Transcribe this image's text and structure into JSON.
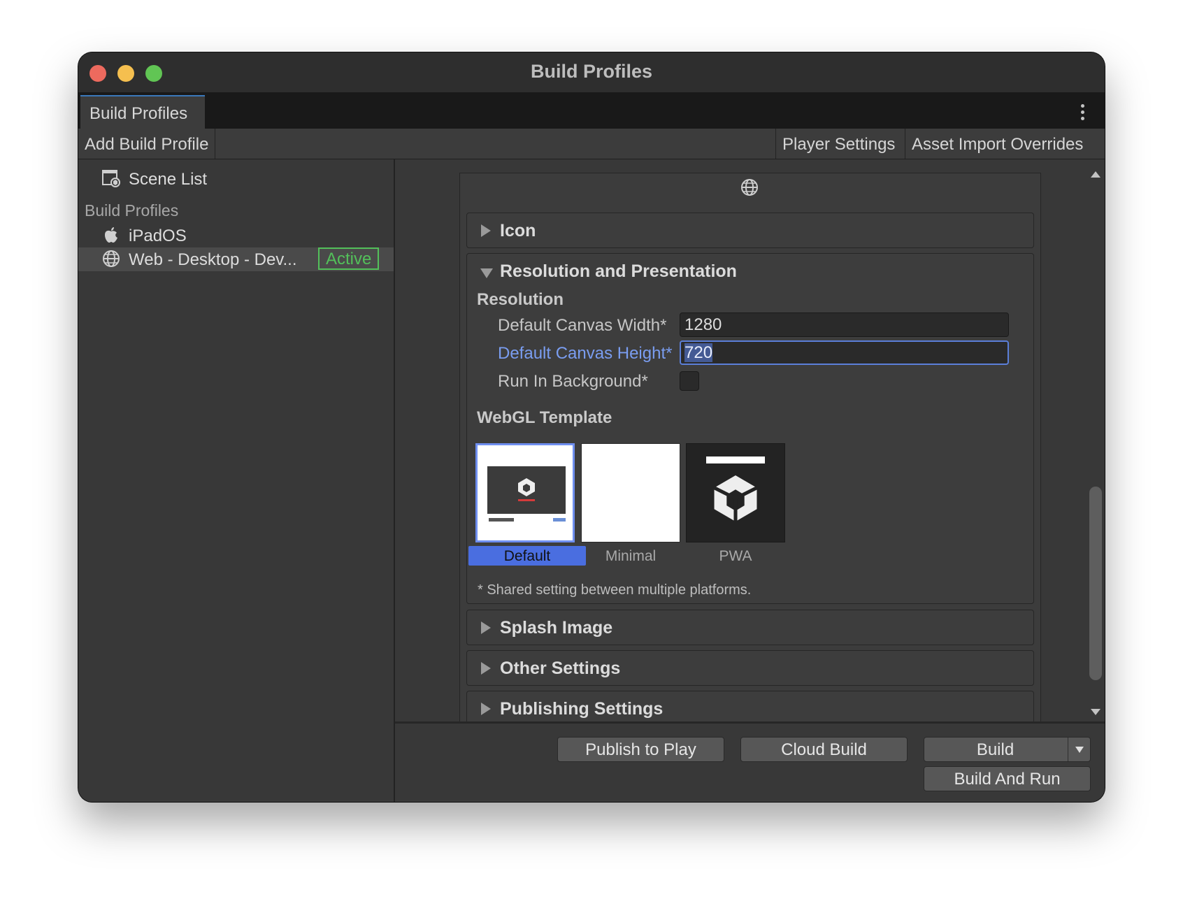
{
  "window": {
    "title": "Build Profiles"
  },
  "tabs": {
    "active_tab": "Build Profiles"
  },
  "toolbar": {
    "add_build_profile": "Add Build Profile",
    "player_settings": "Player Settings",
    "asset_import_overrides": "Asset Import Overrides"
  },
  "sidebar": {
    "scene_list": "Scene List",
    "header": "Build Profiles",
    "items": [
      {
        "label": "iPadOS",
        "icon": "apple-icon"
      },
      {
        "label": "Web - Desktop - Dev...",
        "icon": "globe-icon",
        "badge": "Active"
      }
    ]
  },
  "sections": {
    "icon": "Icon",
    "resolution_presentation": "Resolution and Presentation",
    "splash_image": "Splash Image",
    "other_settings": "Other Settings",
    "publishing_settings": "Publishing Settings"
  },
  "resolution": {
    "header": "Resolution",
    "width_label": "Default Canvas Width*",
    "width_value": "1280",
    "height_label": "Default Canvas Height*",
    "height_value": "720",
    "run_bg_label": "Run In Background*",
    "run_bg_checked": false
  },
  "webgl_template": {
    "header": "WebGL Template",
    "options": [
      "Default",
      "Minimal",
      "PWA"
    ],
    "selected": "Default",
    "note": "* Shared setting between multiple platforms."
  },
  "footer": {
    "publish_to_play": "Publish to Play",
    "cloud_build": "Cloud Build",
    "build": "Build",
    "build_and_run": "Build And Run"
  },
  "colors": {
    "accent": "#4a6ee0",
    "active_badge": "#53c05a",
    "focus_label": "#7a9df0"
  }
}
